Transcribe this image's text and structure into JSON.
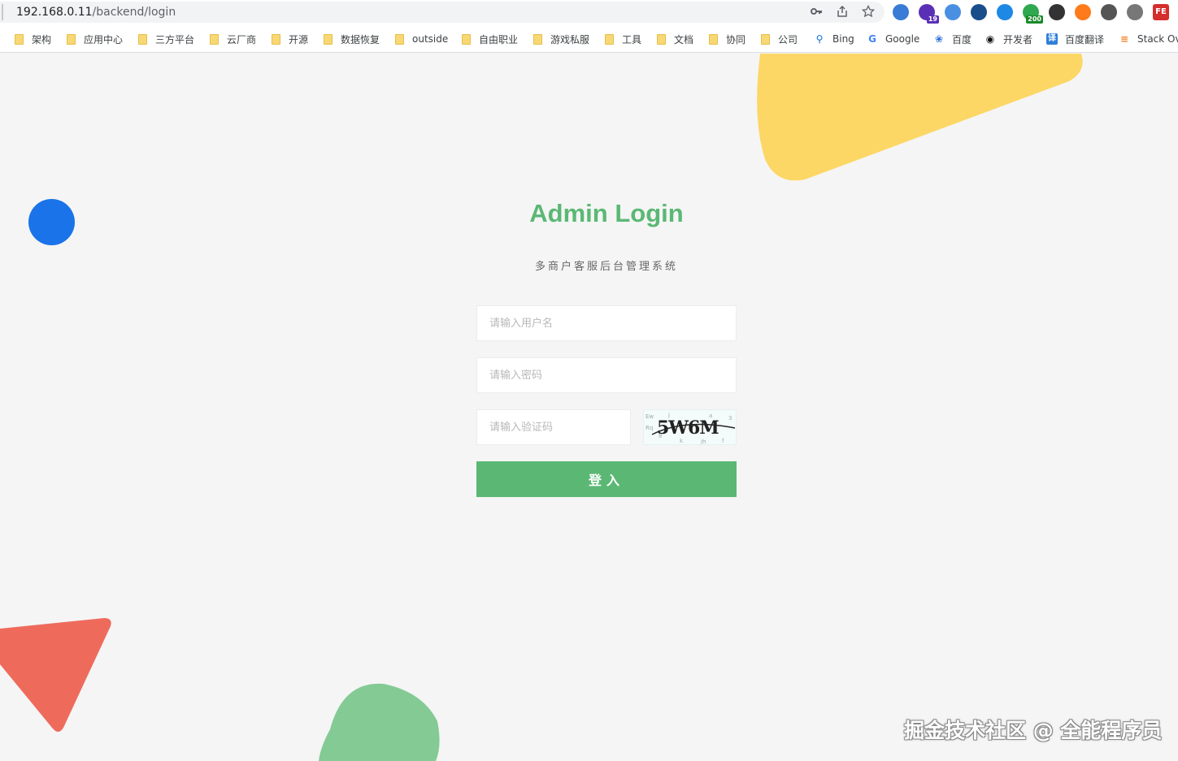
{
  "browser": {
    "url_host": "192.168.0.11",
    "url_path": "/backend/login",
    "address_icons": [
      "key-icon",
      "share-icon",
      "star-icon"
    ],
    "extensions": [
      {
        "name": "globe-extension-icon",
        "color": "#3a7bd5"
      },
      {
        "name": "graduation-extension-icon",
        "color": "#5b2fb5",
        "badge": "19",
        "badge_color": "#5b2fb5"
      },
      {
        "name": "layers-extension-icon",
        "color": "#4a90e2"
      },
      {
        "name": "check-extension-icon",
        "color": "#1a4e8a"
      },
      {
        "name": "earth-extension-icon",
        "color": "#1e88e5"
      },
      {
        "name": "android-extension-icon",
        "color": "#2fa84f",
        "badge": "200",
        "badge_color": "#1a8a2a"
      },
      {
        "name": "x-extension-icon",
        "color": "#333333"
      },
      {
        "name": "moon-extension-icon",
        "color": "#ff7a1a"
      },
      {
        "name": "gauge-extension-icon",
        "color": "#555555"
      },
      {
        "name": "gear-extension-icon",
        "color": "#777777"
      },
      {
        "name": "fe-extension-icon",
        "color": "#d62d2d",
        "label": "FE"
      }
    ]
  },
  "bookmarks": [
    {
      "label": "架构",
      "type": "folder"
    },
    {
      "label": "应用中心",
      "type": "folder"
    },
    {
      "label": "三方平台",
      "type": "folder"
    },
    {
      "label": "云厂商",
      "type": "folder"
    },
    {
      "label": "开源",
      "type": "folder"
    },
    {
      "label": "数据恢复",
      "type": "folder"
    },
    {
      "label": "outside",
      "type": "folder"
    },
    {
      "label": "自由职业",
      "type": "folder"
    },
    {
      "label": "游戏私服",
      "type": "folder"
    },
    {
      "label": "工具",
      "type": "folder"
    },
    {
      "label": "文档",
      "type": "folder"
    },
    {
      "label": "协同",
      "type": "folder"
    },
    {
      "label": "公司",
      "type": "folder"
    },
    {
      "label": "Bing",
      "type": "link",
      "icon": "bing-icon"
    },
    {
      "label": "Google",
      "type": "link",
      "icon": "google-icon"
    },
    {
      "label": "百度",
      "type": "link",
      "icon": "baidu-icon"
    },
    {
      "label": "开发者",
      "type": "link",
      "icon": "developer-icon"
    },
    {
      "label": "百度翻译",
      "type": "link",
      "icon": "translate-icon"
    },
    {
      "label": "Stack Ov",
      "type": "link",
      "icon": "stackoverflow-icon"
    }
  ],
  "login": {
    "title": "Admin Login",
    "subtitle": "多商户客服后台管理系统",
    "username_placeholder": "请输入用户名",
    "password_placeholder": "请输入密码",
    "captcha_placeholder": "请输入验证码",
    "captcha_text": "5W6M",
    "submit_label": "登入"
  },
  "decorations": {
    "yellow": "#fcd766",
    "blue": "#1a73e8",
    "red": "#ee6b5c",
    "green": "#84ca95"
  },
  "watermark": "掘金技术社区 @ 全能程序员"
}
